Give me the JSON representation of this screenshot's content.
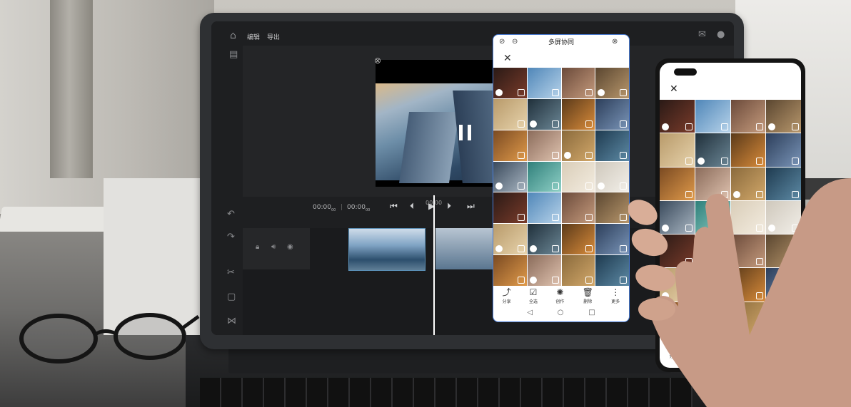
{
  "editor": {
    "menu_edit": "编辑",
    "menu_export": "导出",
    "time_current": "00:00",
    "time_current_unit": "00",
    "time_total": "00:00",
    "time_total_unit": "00",
    "ruler_start": "00:00"
  },
  "multi_screen": {
    "title": "多屏协同"
  },
  "gallery_toolbar": {
    "share": "分享",
    "select_all": "全选",
    "create": "创作",
    "delete": "删除",
    "more": "更多"
  },
  "icons": {
    "home": "home-icon",
    "mail": "mail-icon",
    "close": "close-icon",
    "pause": "pause-icon"
  }
}
